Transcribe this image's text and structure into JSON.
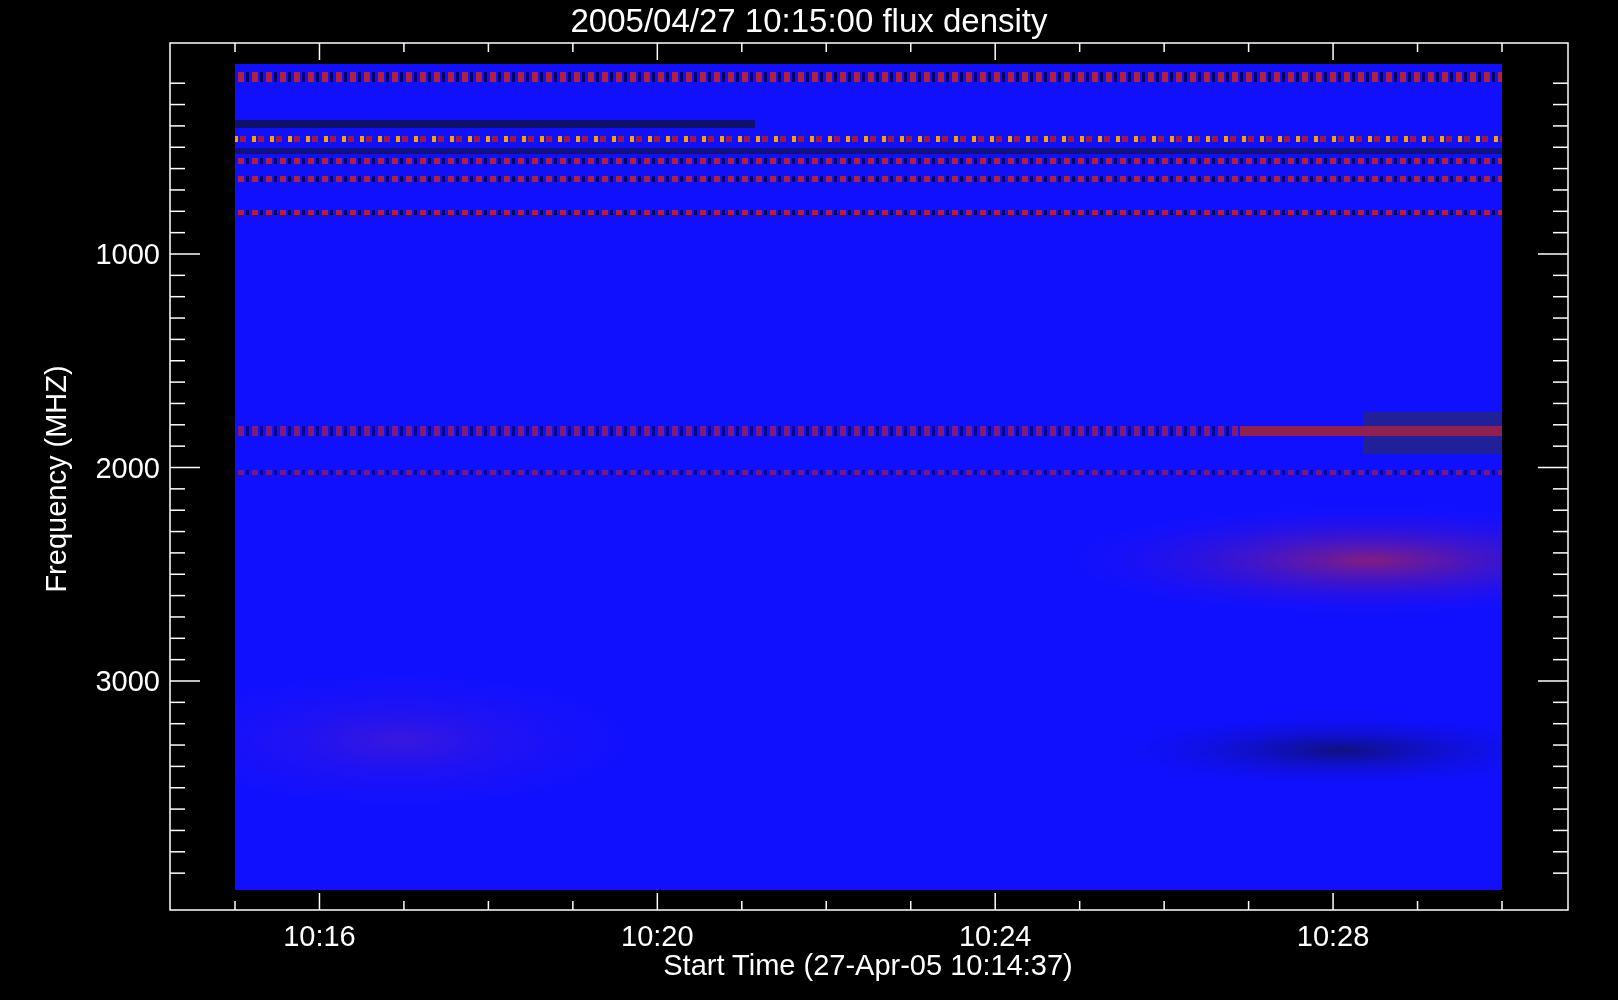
{
  "title": "2005/04/27 10:15:00 flux density",
  "y_axis": {
    "label": "Frequency (MHZ)",
    "ticks": [
      "1000",
      "2000",
      "3000"
    ]
  },
  "x_axis": {
    "label": "Start Time (27-Apr-05 10:14:37)",
    "ticks": [
      "10:16",
      "10:20",
      "10:24",
      "10:28"
    ]
  }
}
